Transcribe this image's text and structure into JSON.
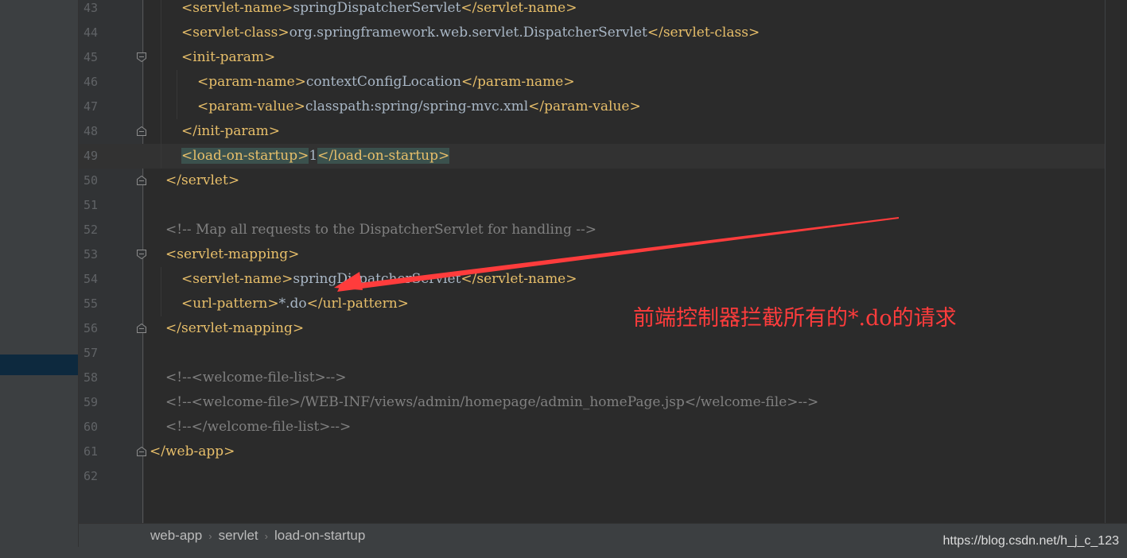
{
  "editor": {
    "lines": [
      {
        "num": "43",
        "indent": 2,
        "fold": "",
        "tokens": [
          {
            "t": "tag",
            "v": "<servlet-name>"
          },
          {
            "t": "txt",
            "v": "springDispatcherServlet"
          },
          {
            "t": "tag",
            "v": "</servlet-name>"
          }
        ]
      },
      {
        "num": "44",
        "indent": 2,
        "fold": "",
        "tokens": [
          {
            "t": "tag",
            "v": "<servlet-class>"
          },
          {
            "t": "txt",
            "v": "org.springframework.web.servlet.DispatcherServlet"
          },
          {
            "t": "tag",
            "v": "</servlet-class>"
          }
        ]
      },
      {
        "num": "45",
        "indent": 2,
        "fold": "open",
        "tokens": [
          {
            "t": "tag",
            "v": "<init-param>"
          }
        ]
      },
      {
        "num": "46",
        "indent": 3,
        "fold": "",
        "tokens": [
          {
            "t": "tag",
            "v": "<param-name>"
          },
          {
            "t": "txt",
            "v": "contextConfigLocation"
          },
          {
            "t": "tag",
            "v": "</param-name>"
          }
        ]
      },
      {
        "num": "47",
        "indent": 3,
        "fold": "",
        "tokens": [
          {
            "t": "tag",
            "v": "<param-value>"
          },
          {
            "t": "txt",
            "v": "classpath:spring/spring-mvc.xml"
          },
          {
            "t": "tag",
            "v": "</param-value>"
          }
        ]
      },
      {
        "num": "48",
        "indent": 2,
        "fold": "close",
        "tokens": [
          {
            "t": "tag",
            "v": "</init-param>"
          }
        ]
      },
      {
        "num": "49",
        "indent": 2,
        "fold": "",
        "current": true,
        "tokens": [
          {
            "t": "tag",
            "v": "<load-on-startup>",
            "hl": true
          },
          {
            "t": "txt",
            "v": "1"
          },
          {
            "t": "tag",
            "v": "</load-on-startup>",
            "hl": true
          }
        ]
      },
      {
        "num": "50",
        "indent": 1,
        "fold": "close",
        "tokens": [
          {
            "t": "tag",
            "v": "</servlet>"
          }
        ]
      },
      {
        "num": "51",
        "indent": 0,
        "fold": "",
        "tokens": []
      },
      {
        "num": "52",
        "indent": 1,
        "fold": "",
        "tokens": [
          {
            "t": "cmt",
            "v": "<!-- Map all requests to the DispatcherServlet for handling -->"
          }
        ]
      },
      {
        "num": "53",
        "indent": 1,
        "fold": "open",
        "tokens": [
          {
            "t": "tag",
            "v": "<servlet-mapping>"
          }
        ]
      },
      {
        "num": "54",
        "indent": 2,
        "fold": "",
        "tokens": [
          {
            "t": "tag",
            "v": "<servlet-name>"
          },
          {
            "t": "txt",
            "v": "springDispatcherServlet"
          },
          {
            "t": "tag",
            "v": "</servlet-name>"
          }
        ]
      },
      {
        "num": "55",
        "indent": 2,
        "fold": "",
        "tokens": [
          {
            "t": "tag",
            "v": "<url-pattern>"
          },
          {
            "t": "txt",
            "v": "*.do"
          },
          {
            "t": "tag",
            "v": "</url-pattern>"
          }
        ]
      },
      {
        "num": "56",
        "indent": 1,
        "fold": "close",
        "tokens": [
          {
            "t": "tag",
            "v": "</servlet-mapping>"
          }
        ]
      },
      {
        "num": "57",
        "indent": 0,
        "fold": "",
        "tokens": []
      },
      {
        "num": "58",
        "indent": 1,
        "fold": "",
        "tokens": [
          {
            "t": "cmt",
            "v": "<!--<welcome-file-list>-->"
          }
        ]
      },
      {
        "num": "59",
        "indent": 1,
        "fold": "",
        "tokens": [
          {
            "t": "cmt",
            "v": "<!--<welcome-file>/WEB-INF/views/admin/homepage/admin_homePage.jsp</welcome-file>-->"
          }
        ]
      },
      {
        "num": "60",
        "indent": 1,
        "fold": "",
        "tokens": [
          {
            "t": "cmt",
            "v": "<!--</welcome-file-list>-->"
          }
        ]
      },
      {
        "num": "61",
        "indent": 0,
        "fold": "close",
        "tokens": [
          {
            "t": "tag",
            "v": "</web-app>"
          }
        ]
      },
      {
        "num": "62",
        "indent": 0,
        "fold": "",
        "tokens": []
      }
    ]
  },
  "annotation": {
    "text": "前端控制器拦截所有的*.do的请求",
    "color": "#ff3c3c"
  },
  "breadcrumb": {
    "items": [
      "web-app",
      "servlet",
      "load-on-startup"
    ],
    "separator": "›"
  },
  "watermark": "https://blog.csdn.net/h_j_c_123",
  "colors": {
    "background": "#2b2b2b",
    "tag": "#e8bf6a",
    "text": "#a9b7c6",
    "comment": "#808080",
    "tag_match_highlight": "#3b514d"
  }
}
